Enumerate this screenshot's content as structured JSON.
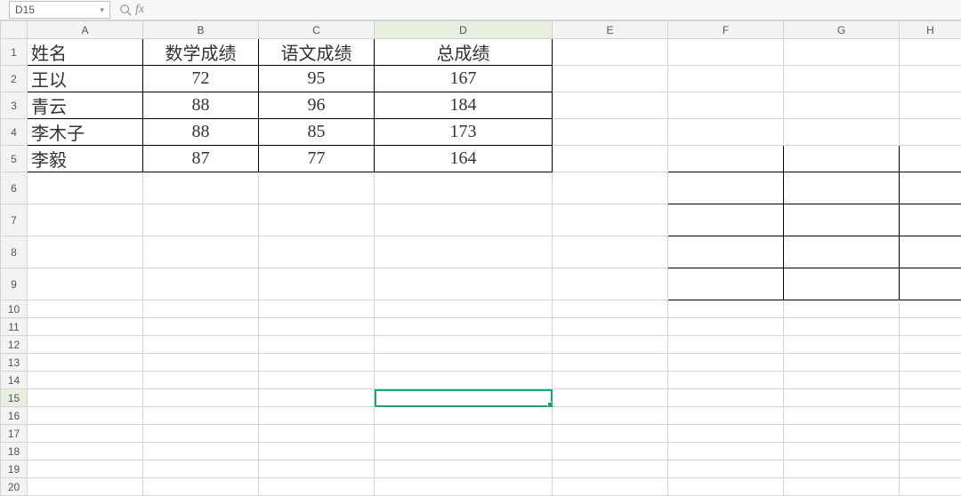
{
  "toolbar": {
    "namebox_value": "D15",
    "search_icon_title": "search",
    "fx_label": "fx"
  },
  "columns": [
    "A",
    "B",
    "C",
    "D",
    "E",
    "F",
    "G",
    "H"
  ],
  "rows": [
    "1",
    "2",
    "3",
    "4",
    "5",
    "6",
    "7",
    "8",
    "9",
    "10",
    "11",
    "12",
    "13",
    "14",
    "15",
    "16",
    "17",
    "18",
    "19",
    "20"
  ],
  "headers": {
    "A1": "姓名",
    "B1": "数学成绩",
    "C1": "语文成绩",
    "D1": "总成绩"
  },
  "data": [
    {
      "name": "王以",
      "math": "72",
      "chinese": "95",
      "total": "167"
    },
    {
      "name": "青云",
      "math": "88",
      "chinese": "96",
      "total": "184"
    },
    {
      "name": "李木子",
      "math": "88",
      "chinese": "85",
      "total": "173"
    },
    {
      "name": "李毅",
      "math": "87",
      "chinese": "77",
      "total": "164"
    }
  ],
  "selection": {
    "cell": "D15"
  },
  "chart_data": {
    "type": "table",
    "columns": [
      "姓名",
      "数学成绩",
      "语文成绩",
      "总成绩"
    ],
    "rows": [
      [
        "王以",
        72,
        95,
        167
      ],
      [
        "青云",
        88,
        96,
        184
      ],
      [
        "李木子",
        88,
        85,
        173
      ],
      [
        "李毅",
        87,
        77,
        164
      ]
    ]
  }
}
